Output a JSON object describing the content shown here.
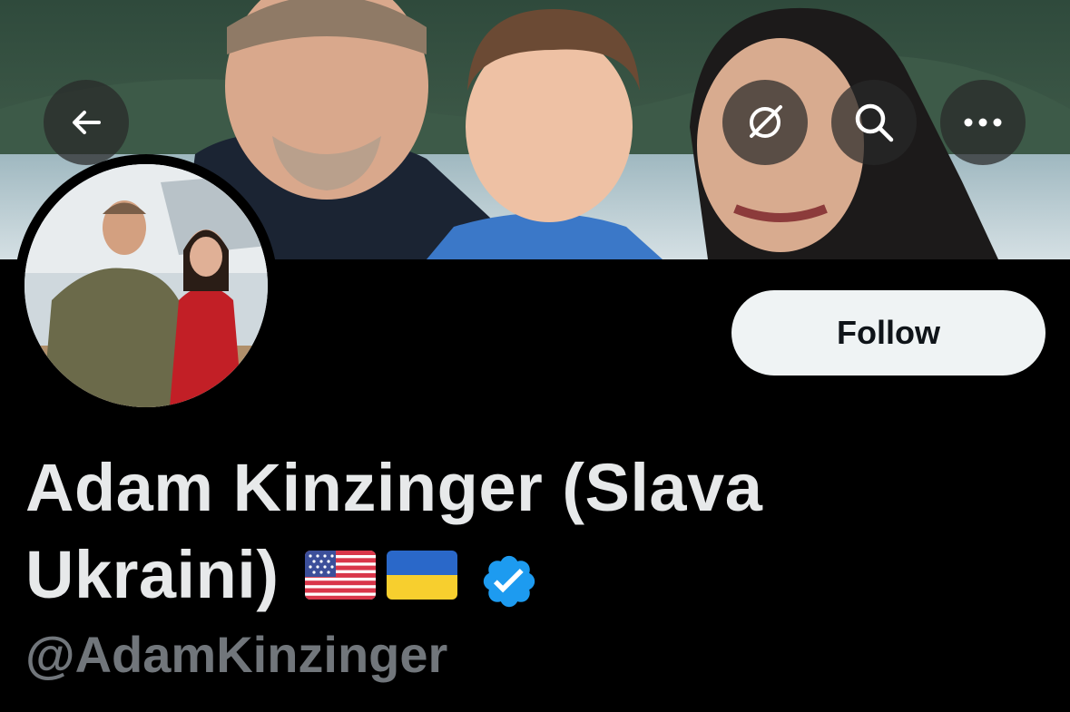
{
  "header": {
    "back_icon": "arrow-left-icon",
    "grok_icon": "grok-icon",
    "search_icon": "search-icon",
    "more_icon": "more-horizontal-icon"
  },
  "profile": {
    "name_line1": "Adam Kinzinger (Slava",
    "name_line2": "Ukraini)",
    "flags": [
      "us-flag-icon",
      "ukraine-flag-icon"
    ],
    "verified_icon": "verified-badge-icon",
    "handle": "@AdamKinzinger"
  },
  "actions": {
    "follow_label": "Follow"
  },
  "colors": {
    "background": "#000000",
    "name_text": "#e7e9ea",
    "handle_text": "#71767b",
    "follow_bg": "#eff3f4",
    "verified_blue": "#1d9bf0"
  }
}
